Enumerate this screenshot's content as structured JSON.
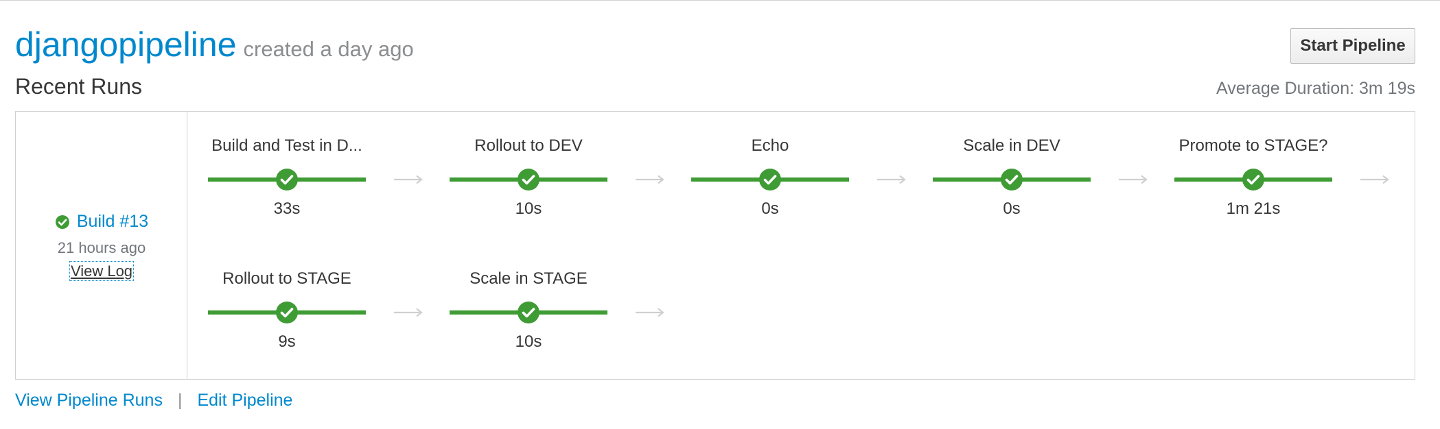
{
  "pipeline": {
    "name": "djangopipeline",
    "created": "created a day ago"
  },
  "actions": {
    "start_label": "Start Pipeline"
  },
  "runs": {
    "heading": "Recent Runs",
    "average_duration": "Average Duration: 3m 19s"
  },
  "build": {
    "label": "Build #13",
    "status": "success",
    "status_icon": "check-circle-icon",
    "time": "21 hours ago",
    "view_log": "View Log"
  },
  "stages": [
    {
      "name": "Build and Test in D...",
      "duration": "33s",
      "status": "success"
    },
    {
      "name": "Rollout to DEV",
      "duration": "10s",
      "status": "success"
    },
    {
      "name": "Echo",
      "duration": "0s",
      "status": "success"
    },
    {
      "name": "Scale in DEV",
      "duration": "0s",
      "status": "success"
    },
    {
      "name": "Promote to STAGE?",
      "duration": "1m 21s",
      "status": "success"
    },
    {
      "name": "Rollout to STAGE",
      "duration": "9s",
      "status": "success"
    },
    {
      "name": "Scale in STAGE",
      "duration": "10s",
      "status": "success"
    }
  ],
  "footer": {
    "view_runs": "View Pipeline Runs",
    "separator": "|",
    "edit": "Edit Pipeline"
  },
  "colors": {
    "link": "#0088ce",
    "success": "#3f9c35",
    "arrow": "#cfcfcf",
    "muted": "#72767b"
  }
}
